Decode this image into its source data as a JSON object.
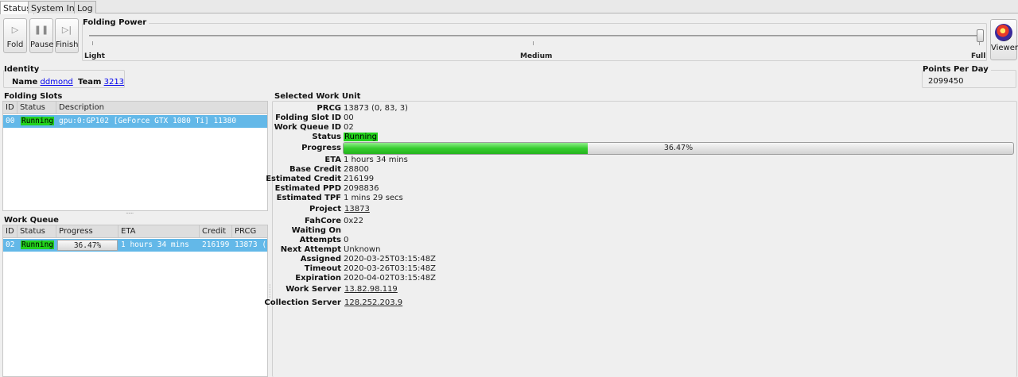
{
  "tabs": [
    {
      "label": "Status",
      "active": true
    },
    {
      "label": "System Info",
      "active": false
    },
    {
      "label": "Log",
      "active": false
    }
  ],
  "toolbar": {
    "fold": "Fold",
    "pause": "Pause",
    "finish": "Finish",
    "viewer": "Viewer"
  },
  "folding_power": {
    "title": "Folding Power",
    "light": "Light",
    "medium": "Medium",
    "full": "Full",
    "level": 1.0
  },
  "identity": {
    "title": "Identity",
    "name_label": "Name",
    "name": "ddmond",
    "team_label": "Team",
    "team": "3213"
  },
  "ppd": {
    "title": "Points Per Day",
    "value": "2099450"
  },
  "folding_slots": {
    "title": "Folding Slots",
    "columns": [
      "ID",
      "Status",
      "Description"
    ],
    "rows": [
      {
        "id": "00",
        "status": "Running",
        "description": "gpu:0:GP102 [GeForce GTX 1080 Ti] 11380"
      }
    ]
  },
  "work_queue": {
    "title": "Work Queue",
    "columns": [
      "ID",
      "Status",
      "Progress",
      "ETA",
      "Credit",
      "PRCG"
    ],
    "rows": [
      {
        "id": "02",
        "status": "Running",
        "progress": "36.47%",
        "eta": "1 hours 34 mins",
        "credit": "216199",
        "prcg": "13873 ("
      }
    ]
  },
  "work_unit": {
    "title": "Selected Work Unit",
    "prcg_label": "PRCG",
    "prcg": "13873 (0, 83, 3)",
    "slot_label": "Folding Slot ID",
    "slot": "00",
    "wq_label": "Work Queue ID",
    "wq": "02",
    "status_label": "Status",
    "status": "Running",
    "progress_label": "Progress",
    "progress": "36.47%",
    "progress_value": 0.3647,
    "eta_label": "ETA",
    "eta": "1 hours 34 mins",
    "base_credit_label": "Base Credit",
    "base_credit": "28800",
    "est_credit_label": "Estimated Credit",
    "est_credit": "216199",
    "est_ppd_label": "Estimated PPD",
    "est_ppd": "2098836",
    "est_tpf_label": "Estimated TPF",
    "est_tpf": "1 mins 29 secs",
    "project_label": "Project",
    "project": "13873",
    "fahcore_label": "FahCore",
    "fahcore": "0x22",
    "waiting_label": "Waiting On",
    "waiting": "",
    "attempts_label": "Attempts",
    "attempts": "0",
    "next_attempt_label": "Next Attempt",
    "next_attempt": "Unknown",
    "assigned_label": "Assigned",
    "assigned": "2020-03-25T03:15:48Z",
    "timeout_label": "Timeout",
    "timeout": "2020-03-26T03:15:48Z",
    "expiration_label": "Expiration",
    "expiration": "2020-04-02T03:15:48Z",
    "work_server_label": "Work Server",
    "work_server": "13.82.98.119",
    "collection_server_label": "Collection Server",
    "collection_server": "128.252.203.9"
  },
  "colors": {
    "selection": "#63b8e8",
    "running": "#22d11c",
    "link": "#0000ee"
  }
}
